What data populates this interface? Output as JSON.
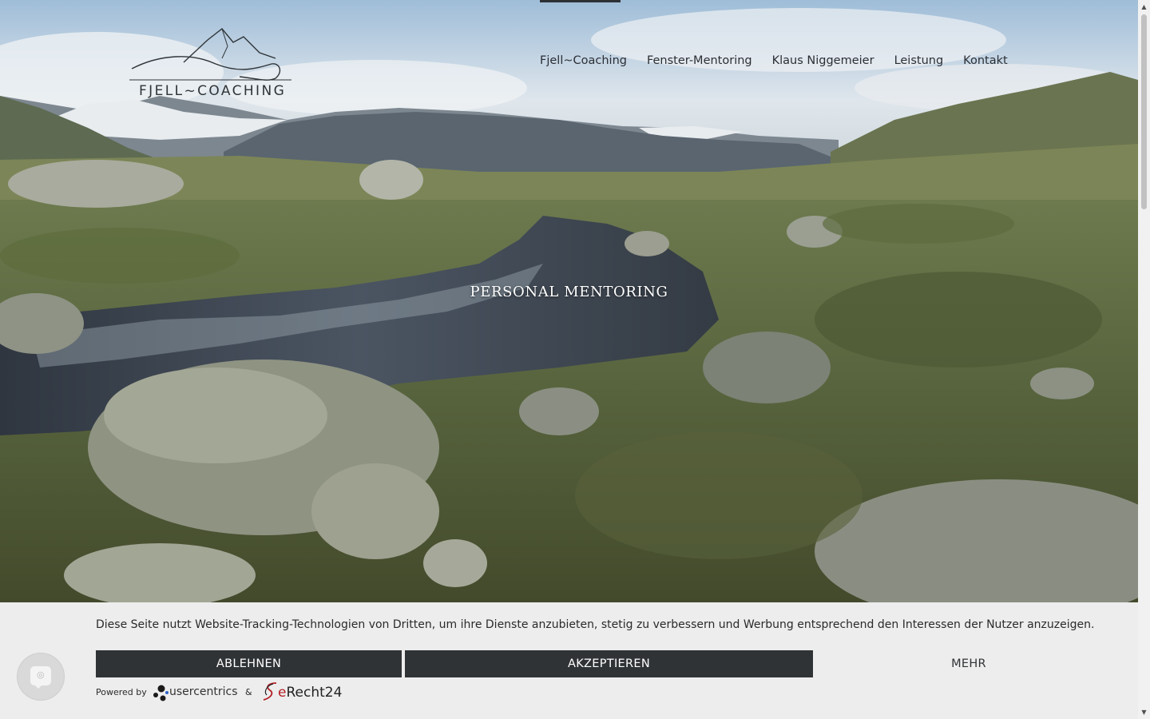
{
  "header": {
    "logo_text": "FJELL~COACHING",
    "nav": [
      {
        "label": "Fjell~Coaching",
        "active": true
      },
      {
        "label": "Fenster-Mentoring",
        "active": false
      },
      {
        "label": "Klaus Niggemeier",
        "active": false
      },
      {
        "label": "Leistung",
        "active": false
      },
      {
        "label": "Kontakt",
        "active": false
      }
    ]
  },
  "hero": {
    "title": "PERSONAL MENTORING"
  },
  "cookie_banner": {
    "text": "Diese Seite nutzt Website-Tracking-Technologien von Dritten, um ihre Dienste anzubieten, stetig zu verbessern und Werbung entsprechend den Interessen der Nutzer anzuzeigen.",
    "reject_label": "ABLEHNEN",
    "accept_label": "AKZEPTIEREN",
    "more_label": "MEHR",
    "powered_by": "Powered by",
    "usercentrics": "usercentrics",
    "amp": "&",
    "erecht_prefix": "e",
    "erecht_rest": "Recht24"
  },
  "colors": {
    "button_dark": "#303336",
    "banner_bg": "#ededed",
    "nav_text": "#2b2f35",
    "erecht_red": "#b31e24"
  },
  "icons": [
    "mountain-logo-icon",
    "fingerprint-icon",
    "usercentrics-logo-icon",
    "erecht24-logo-icon",
    "scroll-up-arrow-icon",
    "scroll-down-arrow-icon"
  ]
}
